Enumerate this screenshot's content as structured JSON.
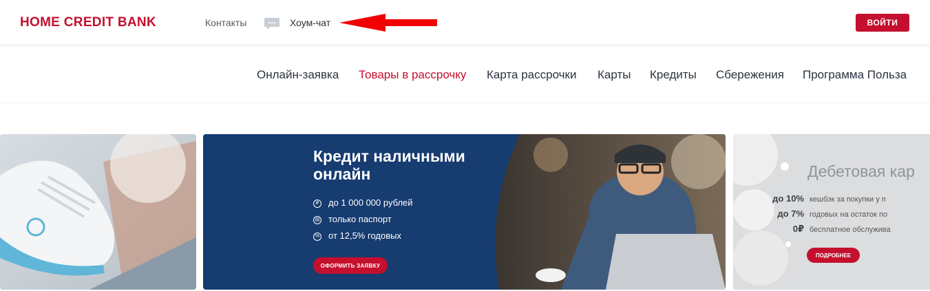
{
  "header": {
    "logo_text": "HOME CREDIT BANK",
    "contacts_label": "Контакты",
    "chat_label": "Хоум-чат",
    "login_label": "ВОЙТИ"
  },
  "nav": {
    "items": [
      {
        "label": "Онлайн-заявка",
        "active": false
      },
      {
        "label": "Товары в рассрочку",
        "active": true
      },
      {
        "label": "Карта рассрочки",
        "active": false
      },
      {
        "label": "Карты",
        "active": false
      },
      {
        "label": "Кредиты",
        "active": false
      },
      {
        "label": "Сбережения",
        "active": false
      },
      {
        "label": "Программа Польза",
        "active": false
      }
    ]
  },
  "banners": {
    "main": {
      "title": "Кредит наличными онлайн",
      "bullets": [
        {
          "icon": "ruble-icon",
          "text": "до 1 000 000 рублей"
        },
        {
          "icon": "passport-icon",
          "text": "только паспорт"
        },
        {
          "icon": "percent-icon",
          "text": "от 12,5% годовых"
        }
      ],
      "button_label": "ОФОРМИТЬ ЗАЯВКУ"
    },
    "right": {
      "title": "Дебетовая кар",
      "rows": [
        {
          "amount": "до 10%",
          "desc": "кешбэк за покупки у п"
        },
        {
          "amount": "до 7%",
          "desc": "годовых на остаток по"
        },
        {
          "amount": "0₽",
          "desc": "бесплатное обслужива"
        }
      ],
      "button_label": "ПОДРОБНЕЕ"
    }
  },
  "colors": {
    "brand_red": "#c4102e",
    "banner_navy": "#163c70",
    "nav_text": "#2b3240"
  }
}
